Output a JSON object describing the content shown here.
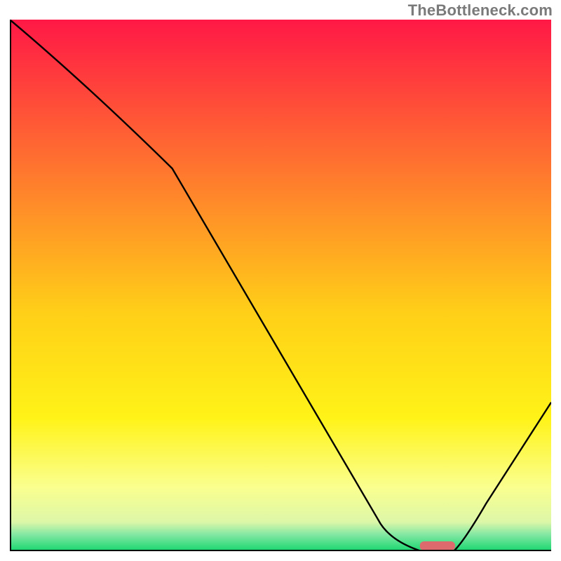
{
  "watermark": "TheBottleneck.com",
  "colors": {
    "gradient_stops": [
      {
        "offset": 0.0,
        "color": "#ff1846"
      },
      {
        "offset": 0.55,
        "color": "#ffcf18"
      },
      {
        "offset": 0.75,
        "color": "#fff318"
      },
      {
        "offset": 0.88,
        "color": "#faff8f"
      },
      {
        "offset": 0.945,
        "color": "#ddf7a8"
      },
      {
        "offset": 0.968,
        "color": "#86e8a4"
      },
      {
        "offset": 1.0,
        "color": "#18d66f"
      }
    ],
    "curve": "#000000",
    "marker": "#dd6b6e",
    "axis": "#000000"
  },
  "chart_data": {
    "type": "line",
    "title": "",
    "xlabel": "",
    "ylabel": "",
    "xlim": [
      0,
      100
    ],
    "ylim": [
      0,
      100
    ],
    "grid": false,
    "legend": false,
    "series": [
      {
        "name": "bottleneck-curve",
        "x": [
          0,
          30,
          70,
          76,
          82,
          100
        ],
        "y": [
          100,
          72,
          4,
          0,
          0,
          28
        ]
      }
    ],
    "marker": {
      "x_start": 76,
      "x_end": 82,
      "y": 0
    },
    "note": "x is normalised position across the plot, y is normalised height; gradient background encodes bottleneck severity (red high → green low)."
  }
}
